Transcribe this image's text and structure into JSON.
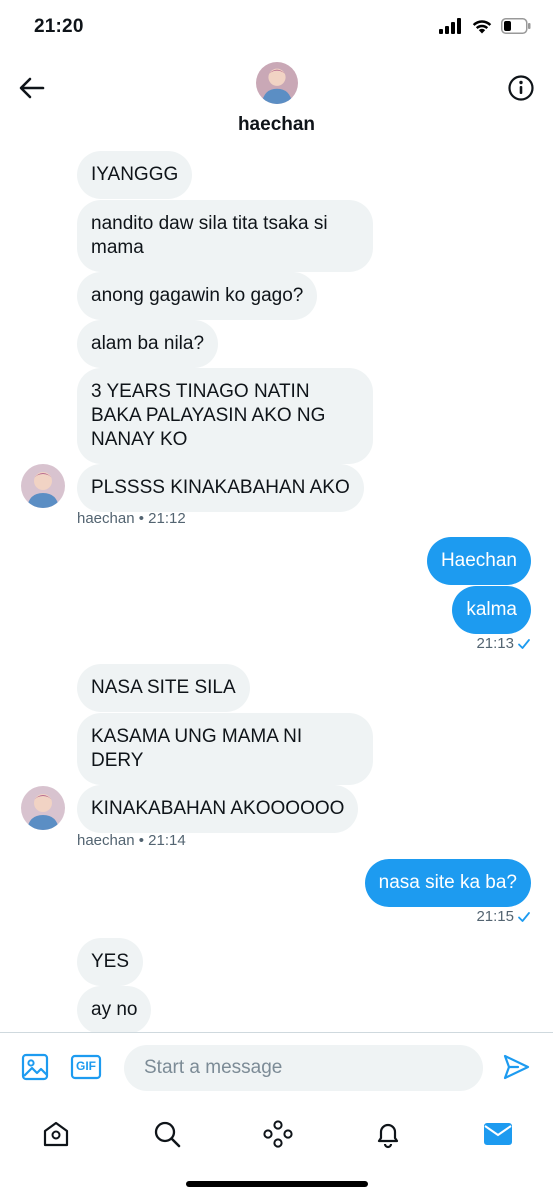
{
  "status_bar": {
    "time": "21:20",
    "icons": [
      "cellular-signal-icon",
      "wifi-icon",
      "battery-icon"
    ]
  },
  "header": {
    "contact_name": "haechan",
    "back_icon": "arrow-left-icon",
    "info_icon": "info-circle-icon"
  },
  "conversation": {
    "group1": {
      "messages": [
        "IYANGGG",
        "nandito daw sila tita tsaka si mama",
        "anong gagawin ko gago?",
        "alam ba nila?",
        "3 YEARS TINAGO NATIN BAKA PALAYASIN AKO NG NANAY KO",
        "PLSSSS KINAKABAHAN AKO"
      ],
      "sender": "haechan",
      "time": "• 21:12"
    },
    "group2": {
      "messages": [
        "Haechan",
        "kalma"
      ],
      "time": "21:13",
      "status_icon": "read-check-icon"
    },
    "group3": {
      "messages": [
        "NASA SITE SILA",
        "KASAMA UNG MAMA NI DERY",
        "KINAKABAHAN AKOOOOOO"
      ],
      "sender": "haechan",
      "time": "• 21:14"
    },
    "group4": {
      "messages": [
        "nasa site ka ba?"
      ],
      "time": "21:15",
      "status_icon": "read-check-icon"
    },
    "group5": {
      "messages": [
        "YES",
        "ay no"
      ]
    }
  },
  "composer": {
    "placeholder": "Start a message",
    "image_icon": "image-icon",
    "gif_label": "GIF",
    "send_icon": "send-icon"
  },
  "tab_bar": {
    "tabs": [
      "home-icon",
      "search-icon",
      "spaces-icon",
      "bell-icon",
      "mail-icon"
    ],
    "active": "mail-icon"
  },
  "colors": {
    "accent": "#1d9bf0",
    "incoming_bubble": "#eff3f4",
    "text": "#0f1419",
    "muted": "#536471"
  }
}
